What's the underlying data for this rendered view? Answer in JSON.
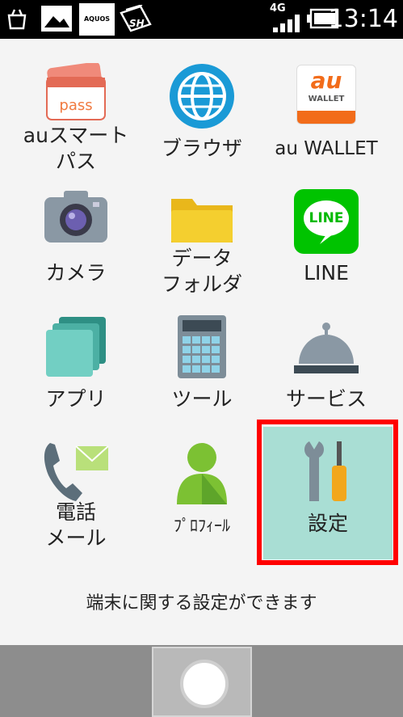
{
  "status": {
    "time": "13:14",
    "network": "4G",
    "left_icons": [
      "shopping-bag-icon",
      "image-icon",
      "aquos-icon",
      "sh-icon"
    ],
    "aquos_text": "AQUOS",
    "sh_text": "SH"
  },
  "tiles": [
    {
      "label": "auスマート\nパス",
      "icon": "au-smartpass-icon",
      "pass_text": "pass"
    },
    {
      "label": "ブラウザ",
      "icon": "browser-globe-icon"
    },
    {
      "label": "au WALLET",
      "icon": "au-wallet-icon",
      "logo_text": "au",
      "sub_text": "WALLET"
    },
    {
      "label": "カメラ",
      "icon": "camera-icon"
    },
    {
      "label": "データ\nフォルダ",
      "icon": "folder-icon"
    },
    {
      "label": "LINE",
      "icon": "line-icon",
      "logo_text": "LINE"
    },
    {
      "label": "アプリ",
      "icon": "apps-stack-icon"
    },
    {
      "label": "ツール",
      "icon": "calculator-icon"
    },
    {
      "label": "サービス",
      "icon": "service-bell-icon"
    },
    {
      "label": "電話\nメール",
      "icon": "phone-mail-icon"
    },
    {
      "label": "ﾌﾟﾛﾌｨｰﾙ",
      "icon": "profile-icon"
    },
    {
      "label": "設定",
      "icon": "settings-tools-icon",
      "selected": true
    }
  ],
  "hint_text": "端末に関する設定ができます",
  "colors": {
    "selection_outline": "#ff0000",
    "selected_tile": "#a9ded4",
    "nav_bar": "#8d8d8d"
  }
}
